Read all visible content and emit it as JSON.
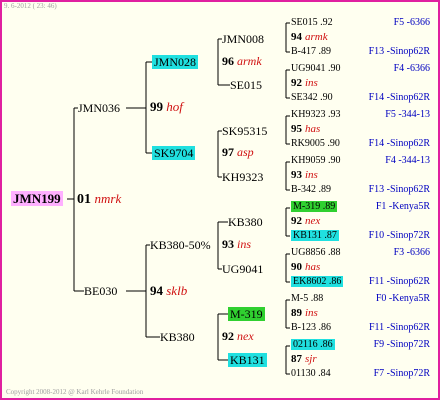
{
  "header": {
    "date": "9. 6-2012 ( 23: 46)"
  },
  "footer": {
    "copyright": "Copyright 2008-2012 @ Karl Kehrle Foundation"
  },
  "colors": {
    "frame": "#e020a0",
    "highlight_cyan": "#20e0e0",
    "highlight_green": "#30d030",
    "highlight_pink": "#ffb0ff",
    "mark": "#d01010",
    "code": "#0000c0"
  },
  "gen1": {
    "name": "JMN199"
  },
  "gen2": {
    "num": "01",
    "mark": "nmrk"
  },
  "gen3": {
    "a": {
      "name": "JMN036",
      "num": "99",
      "mark": "hof"
    },
    "b": {
      "name": "BE030",
      "num": "94",
      "mark": "sklb"
    }
  },
  "gen4": {
    "a": {
      "name": "JMN028",
      "num": "96",
      "mark": "armk"
    },
    "b": {
      "name": "SE015"
    },
    "c": {
      "name": "SK9704",
      "num": "97",
      "mark": "asp"
    },
    "d": {
      "name": "KH9323"
    },
    "e": {
      "name": "KB380-50%",
      "num": "93",
      "mark": "ins"
    },
    "f": {
      "name": "KB380",
      "num": "92",
      "mark": "nex"
    }
  },
  "gen5": {
    "a": {
      "name": "JMN008"
    },
    "b": {
      "name": "SE015"
    },
    "c": {
      "name": "SK95315"
    },
    "d": {
      "name": "KH9323"
    },
    "e": {
      "name": "KB380"
    },
    "f": {
      "name": "UG9041"
    },
    "g": {
      "name": "M-319"
    },
    "h": {
      "name": "KB131"
    }
  },
  "right": [
    {
      "top": "SE015 .92",
      "mid_num": "94",
      "mid_mark": "armk",
      "bot": "B-417 .89",
      "code1": "F5 -6366",
      "code2": "F13 -Sinop62R"
    },
    {
      "top": "UG9041 .90",
      "mid_num": "92",
      "mid_mark": "ins",
      "bot": "SE342 .90",
      "code1": "F4 -6366",
      "code2": "F14 -Sinop62R"
    },
    {
      "top": "KH9323 .93",
      "mid_num": "95",
      "mid_mark": "has",
      "bot": "RK9005 .90",
      "code1": "F5 -344-13",
      "code2": "F14 -Sinop62R"
    },
    {
      "top": "KH9059 .90",
      "mid_num": "93",
      "mid_mark": "ins",
      "bot": "B-342 .89",
      "code1": "F4 -344-13",
      "code2": "F13 -Sinop62R"
    },
    {
      "top": "M-319 .89",
      "mid_num": "92",
      "mid_mark": "nex",
      "bot": "KB131 .87",
      "code1": "F1 -Kenya5R",
      "code2": "F10 -Sinop72R"
    },
    {
      "top": "UG8856 .88",
      "mid_num": "90",
      "mid_mark": "has",
      "bot": "EK8602 .86",
      "code1": "F3 -6366",
      "code2": "F11 -Sinop62R"
    },
    {
      "top": "M-5 .88",
      "mid_num": "89",
      "mid_mark": "ins",
      "bot": "B-123 .86",
      "code1": "F0 -Kenya5R",
      "code2": "F11 -Sinop62R"
    },
    {
      "top": "02116 .86",
      "mid_num": "87",
      "mid_mark": "sjr",
      "bot": "01130 .84",
      "code1": "F9 -Sinop72R",
      "code2": "F7 -Sinop72R"
    }
  ]
}
